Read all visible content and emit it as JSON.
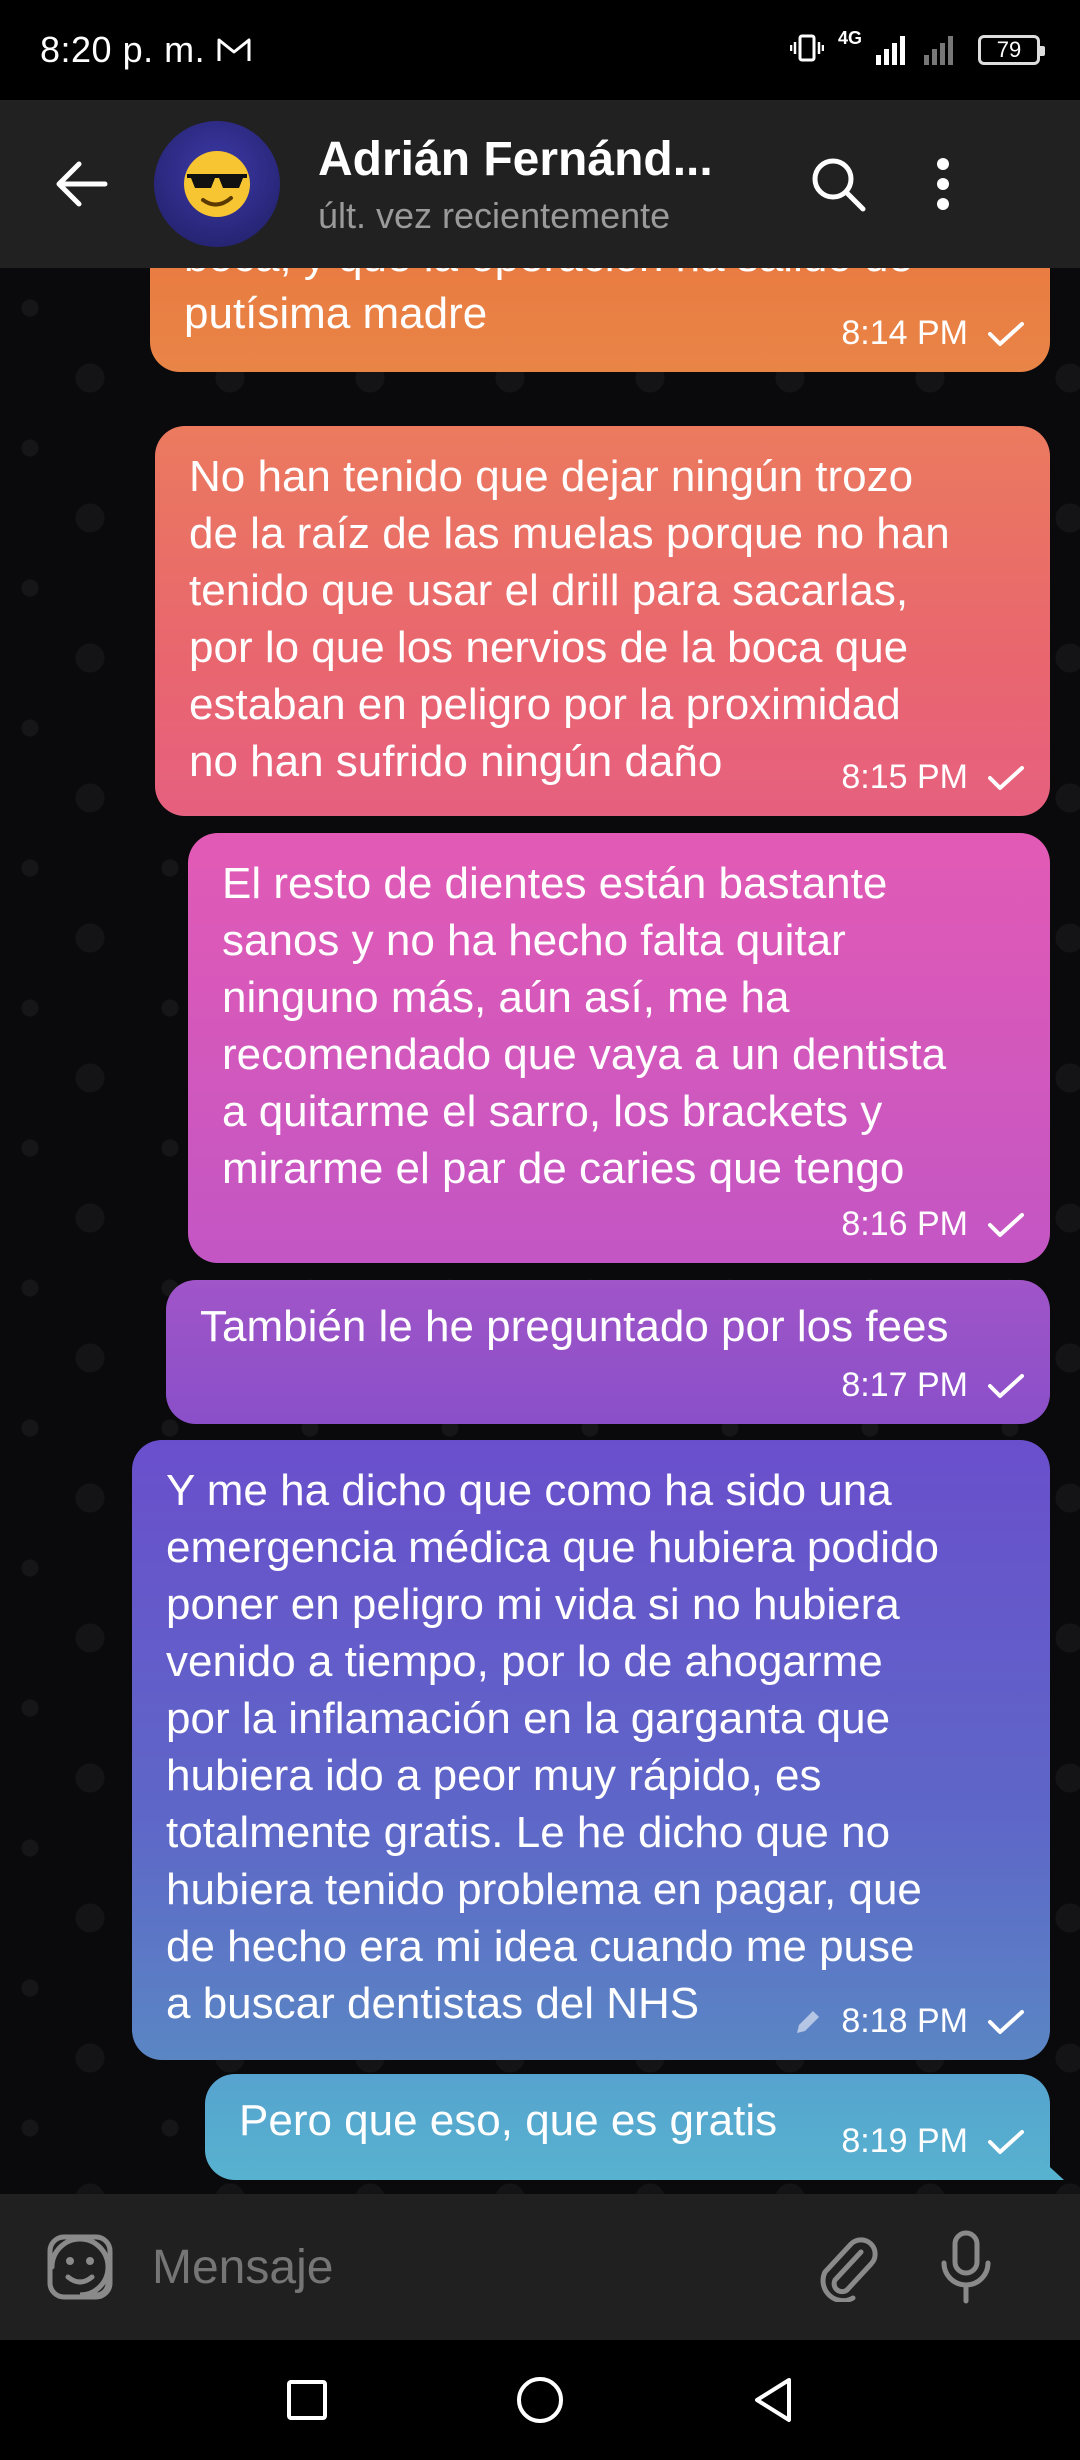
{
  "status_bar": {
    "time": "8:20 p. m.",
    "network": "4G",
    "battery": "79"
  },
  "header": {
    "contact_name": "Adrián Fernánd...",
    "last_seen": "últ. vez recientemente",
    "avatar_icon": "sunglasses-face-emoji"
  },
  "messages": [
    {
      "text": "boca, y que la operación ha salido de\nputísima madre",
      "time": "8:14 PM",
      "status": "sent-check"
    },
    {
      "text": "No han tenido que dejar ningún trozo\nde la raíz de las muelas porque no han\ntenido que usar el drill para sacarlas,\npor lo que los nervios de la boca que\nestaban en peligro por la proximidad\nno han sufrido ningún daño",
      "time": "8:15 PM",
      "status": "sent-check"
    },
    {
      "text": "El resto de dientes están bastante\nsanos y no ha hecho falta quitar\nninguno más, aún así, me ha\nrecomendado que vaya a un dentista\na quitarme el sarro, los brackets y\nmirarme el par de caries que tengo",
      "time": "8:16 PM",
      "status": "sent-check"
    },
    {
      "text": "También le he preguntado por los fees",
      "time": "8:17 PM",
      "status": "sent-check"
    },
    {
      "text": "Y me ha dicho que como ha sido una\nemergencia médica que hubiera podido\nponer en peligro mi vida si no hubiera\nvenido a tiempo, por lo de ahogarme\npor la inflamación en la garganta que\nhubiera ido a peor muy rápido, es\ntotalmente gratis. Le he dicho que no\nhubiera tenido problema en pagar, que\nde hecho era mi idea cuando me puse\na buscar dentistas del NHS",
      "time": "8:18 PM",
      "status": "sent-check",
      "edited": true
    },
    {
      "text": "Pero que eso, que es gratis",
      "time": "8:19 PM",
      "status": "sent-check"
    }
  ],
  "composer": {
    "placeholder": "Mensaje"
  },
  "colors": {
    "header_bg": "#212121",
    "chat_bg": "#0a0a0c",
    "bubble_orange": "#e9793f",
    "bubble_pink": "#e25ab5",
    "bubble_purple": "#6a4fcc",
    "bubble_blue": "#57b2cf"
  }
}
